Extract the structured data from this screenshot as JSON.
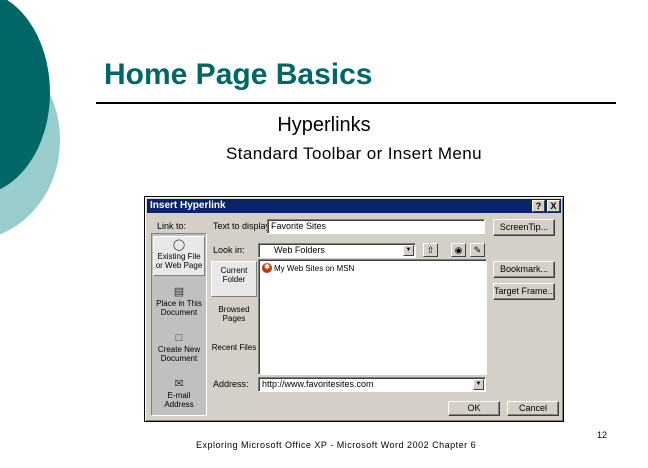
{
  "slide": {
    "title": "Home Page Basics",
    "subtitle": "Hyperlinks",
    "subheading": "Standard Toolbar or Insert Menu",
    "footer": "Exploring Microsoft Office XP - Microsoft Word 2002 Chapter 6",
    "page_number": "12"
  },
  "dialog": {
    "title": "Insert Hyperlink",
    "help_btn": "?",
    "close_btn": "X",
    "link_to_label": "Link to:",
    "text_to_display_label": "Text to display:",
    "text_to_display_value": "Favorite Sites",
    "screentip_btn": "ScreenTip...",
    "look_in_label": "Look in:",
    "look_in_value": "Web Folders",
    "bookmark_btn": "Bookmark...",
    "target_frame_btn": "Target Frame...",
    "address_label": "Address:",
    "address_value": "http://www.favoritesites.com",
    "ok_btn": "OK",
    "cancel_btn": "Cancel",
    "link_bar": [
      {
        "label": "Existing File or Web Page"
      },
      {
        "label": "Place in This Document"
      },
      {
        "label": "Create New Document"
      },
      {
        "label": "E-mail Address"
      }
    ],
    "tabs": [
      {
        "label": "Current Folder"
      },
      {
        "label": "Browsed Pages"
      },
      {
        "label": "Recent Files"
      }
    ],
    "list_items": [
      {
        "label": "My Web Sites on MSN"
      }
    ]
  },
  "colors": {
    "title": "#006666",
    "deco_dark": "#006666",
    "deco_light": "#99cccc",
    "titlebar": "#0a246a"
  }
}
